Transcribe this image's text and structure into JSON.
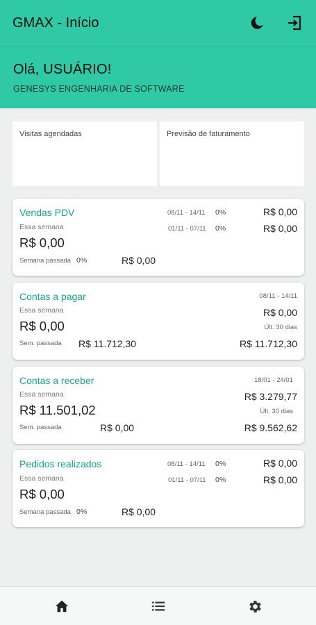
{
  "appbar": {
    "title": "GMAX - Início",
    "theme_icon": "moon-icon",
    "logout_icon": "logout-icon"
  },
  "hero": {
    "greeting": "Olá, USUÁRIO!",
    "company": "GENESYS ENGENHARIA DE SOFTWARE"
  },
  "summary": {
    "visits_label": "Visitas agendadas",
    "forecast_label": "Previsão de faturamento"
  },
  "cards": {
    "vendas": {
      "title": "Vendas PDV",
      "this_week_label": "Essa semana",
      "this_week_value": "R$ 0,00",
      "last_week_label": "Semana passada",
      "last_week_pct": "0%",
      "last_week_value": "R$ 0,00",
      "range1": "08/11 - 14/11",
      "range1_pct": "0%",
      "range1_value": "R$ 0,00",
      "range2": "01/11 - 07/11",
      "range2_pct": "0%",
      "range2_value": "R$ 0,00"
    },
    "pagar": {
      "title": "Contas a pagar",
      "this_week_label": "Essa semana",
      "this_week_value": "R$ 0,00",
      "last_week_label": "Sem. passada",
      "last_week_value": "R$ 11.712,30",
      "range": "08/11 - 14/11",
      "range_value": "R$ 0,00",
      "last30_label": "Últ. 30 dias",
      "last30_value": "R$ 11.712,30"
    },
    "receber": {
      "title": "Contas a receber",
      "this_week_label": "Essa semana",
      "this_week_value": "R$ 11.501,02",
      "last_week_label": "Sem. passada",
      "last_week_value": "R$ 0,00",
      "range": "18/01 - 24/01",
      "range_value": "R$ 3.279,77",
      "last30_label": "Últ. 30 dias",
      "last30_value": "R$ 9.562,62"
    },
    "pedidos": {
      "title": "Pedidos realizados",
      "this_week_label": "Essa semana",
      "this_week_value": "R$ 0,00",
      "last_week_label": "Semana passada",
      "last_week_pct": "0%",
      "last_week_value": "R$ 0,00",
      "range1": "08/11 - 14/11",
      "range1_pct": "0%",
      "range1_value": "R$ 0,00",
      "range2": "01/11 - 07/11",
      "range2_pct": "0%",
      "range2_value": "R$ 0,00"
    }
  },
  "bottomnav": {
    "home_icon": "home-icon",
    "list_icon": "list-icon",
    "settings_icon": "gear-icon"
  },
  "colors": {
    "accent": "#2fc9a5",
    "card_title": "#11a883",
    "background": "#eef0ef"
  }
}
